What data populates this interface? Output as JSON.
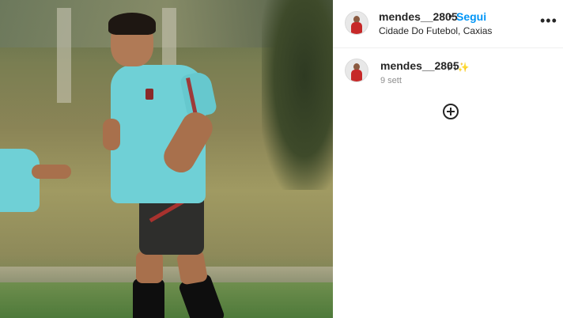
{
  "post": {
    "image_alt": "",
    "author": {
      "username": "mendes__2805",
      "follow_label": "Segui",
      "location": "Cidade Do Futebol, Caxias"
    },
    "comment": {
      "username": "mendes__2805",
      "text": "PT",
      "emoji": "✨",
      "date": "9 sett"
    },
    "icons": {
      "more": "more-options-icon",
      "add": "add-circle-icon"
    }
  }
}
